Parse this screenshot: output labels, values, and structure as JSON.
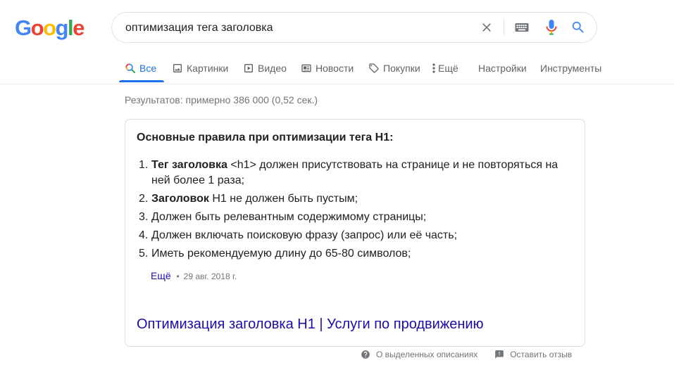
{
  "logo": {
    "letters": [
      "G",
      "o",
      "o",
      "g",
      "l",
      "e"
    ],
    "colors": [
      "#4285f4",
      "#ea4335",
      "#fbbc05",
      "#4285f4",
      "#34a853",
      "#ea4335"
    ]
  },
  "search": {
    "query": "оптимизация тега заголовка"
  },
  "tabs": [
    {
      "label": "Все",
      "icon": "search-icon",
      "active": true
    },
    {
      "label": "Картинки",
      "icon": "image-icon"
    },
    {
      "label": "Видео",
      "icon": "video-icon"
    },
    {
      "label": "Новости",
      "icon": "news-icon"
    },
    {
      "label": "Покупки",
      "icon": "tag-icon"
    },
    {
      "label": "Ещё",
      "icon": "more-vert-icon"
    },
    {
      "label": "Настройки"
    },
    {
      "label": "Инструменты"
    }
  ],
  "results_count": "Результатов: примерно 386 000 (0,52 сек.)",
  "snippet": {
    "heading": "Основные правила при оптимизации тега H1:",
    "items": [
      {
        "num": "1.",
        "bold": "Тег заголовка",
        "text": " <h1> должен присутствовать на странице и не повторяться на ней более 1 раза;"
      },
      {
        "num": "2.",
        "bold": "Заголовок",
        "text": " H1 не должен быть пустым;"
      },
      {
        "num": "3.",
        "bold": "",
        "text": "Должен быть релевантным содержимому страницы;"
      },
      {
        "num": "4.",
        "bold": "",
        "text": "Должен включать поисковую фразу (запрос) или её часть;"
      },
      {
        "num": "5.",
        "bold": "",
        "text": "Иметь рекомендуемую длину до 65-80 символов;"
      }
    ],
    "more_label": "Ещё",
    "separator": "•",
    "date": "29 авг. 2018 г.",
    "result_title": "Оптимизация заголовка H1 | Услуги по продвижению"
  },
  "footer": {
    "about_label": "О выделенных описаниях",
    "feedback_label": "Оставить отзыв"
  },
  "colors": {
    "link": "#1a0dab",
    "accent": "#1a73e8",
    "muted": "#70757a"
  }
}
